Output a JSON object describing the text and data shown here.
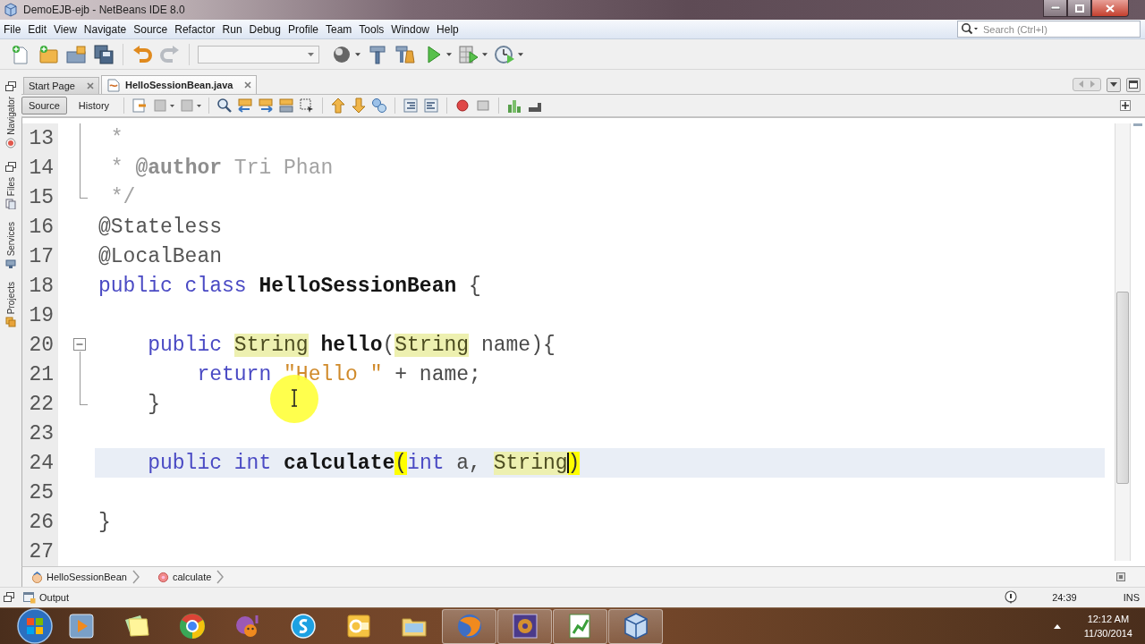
{
  "window": {
    "title": "DemoEJB-ejb - NetBeans IDE 8.0"
  },
  "menu": [
    "File",
    "Edit",
    "View",
    "Navigate",
    "Source",
    "Refactor",
    "Run",
    "Debug",
    "Profile",
    "Team",
    "Tools",
    "Window",
    "Help"
  ],
  "search": {
    "placeholder": "Search (Ctrl+I)"
  },
  "side_panels": [
    {
      "tabs": [
        {
          "label": "Navigator",
          "kind": "navigator"
        }
      ]
    },
    {
      "tabs": [
        {
          "label": "Files",
          "kind": "files"
        },
        {
          "label": "Services",
          "kind": "services"
        },
        {
          "label": "Projects",
          "kind": "projects"
        }
      ]
    }
  ],
  "editor_tabs": [
    {
      "label": "Start Page",
      "kind": "page",
      "selected": false
    },
    {
      "label": "HelloSessionBean.java",
      "kind": "java-file",
      "selected": true
    }
  ],
  "view_buttons": [
    {
      "label": "Source",
      "selected": true
    },
    {
      "label": "History",
      "selected": false
    }
  ],
  "code": {
    "lines": [
      {
        "number": "13",
        "current": false,
        "fold_guide": true,
        "fold_end": false,
        "tokens": [
          {
            "text": " *",
            "kind": "comment"
          }
        ]
      },
      {
        "number": "14",
        "current": false,
        "fold_guide": true,
        "fold_end": false,
        "tokens": [
          {
            "text": " * ",
            "kind": "comment"
          },
          {
            "text": "@author",
            "kind": "doc-tag"
          },
          {
            "text": " Tri Phan",
            "kind": "comment"
          }
        ]
      },
      {
        "number": "15",
        "current": false,
        "fold_guide": false,
        "fold_end": true,
        "tokens": [
          {
            "text": " */",
            "kind": "comment"
          }
        ]
      },
      {
        "number": "16",
        "current": false,
        "fold_guide": false,
        "fold_end": false,
        "tokens": [
          {
            "text": "@Stateless",
            "kind": "annotation"
          }
        ]
      },
      {
        "number": "17",
        "current": false,
        "fold_guide": false,
        "fold_end": false,
        "tokens": [
          {
            "text": "@LocalBean",
            "kind": "annotation"
          }
        ]
      },
      {
        "number": "18",
        "current": false,
        "fold_guide": false,
        "fold_end": false,
        "tokens": [
          {
            "text": "public class ",
            "kind": "keyword"
          },
          {
            "text": "HelloSessionBean",
            "kind": "declaration"
          },
          {
            "text": " {",
            "kind": "plain"
          }
        ],
        "children": [
          {
            "number": "19",
            "current": false,
            "fold_guide": false,
            "fold_end": false
          },
          {
            "number": "20",
            "current": false,
            "fold_guide": false,
            "fold_end": false,
            "expanded": true,
            "tokens": [
              {
                "text": "public ",
                "kind": "keyword"
              },
              {
                "text": "String",
                "kind": "occurrence"
              },
              {
                "text": " hello",
                "kind": "declaration"
              },
              {
                "text": "(",
                "kind": "plain"
              },
              {
                "text": "String",
                "kind": "occurrence"
              },
              {
                "text": " name){",
                "kind": "plain"
              }
            ],
            "children": [
              {
                "number": "21",
                "current": false,
                "fold_guide": true,
                "fold_end": false,
                "tokens": [
                  {
                    "text": "return ",
                    "kind": "keyword"
                  },
                  {
                    "text": "\"Hello \"",
                    "kind": "string"
                  },
                  {
                    "text": " + name;",
                    "kind": "plain"
                  }
                ]
              }
            ]
          },
          {
            "number": "22",
            "current": false,
            "fold_guide": false,
            "fold_end": true,
            "tokens": [
              {
                "text": "}",
                "kind": "plain"
              }
            ]
          },
          {
            "number": "23",
            "current": false,
            "fold_guide": false,
            "fold_end": false
          },
          {
            "number": "24",
            "current": true,
            "fold_guide": false,
            "fold_end": false,
            "tokens": [
              {
                "text": "public int ",
                "kind": "keyword"
              },
              {
                "text": "calculate",
                "kind": "declaration"
              },
              {
                "text": "(",
                "kind": "brace-match"
              },
              {
                "text": "int",
                "kind": "keyword"
              },
              {
                "text": " a, ",
                "kind": "plain"
              },
              {
                "text": "String",
                "kind": "occurrence"
              },
              {
                "text": ")",
                "kind": "brace-match",
                "caret": true
              }
            ]
          },
          {
            "number": "25",
            "current": false,
            "fold_guide": false,
            "fold_end": false
          }
        ]
      },
      {
        "number": "26",
        "current": false,
        "fold_guide": false,
        "fold_end": false,
        "tokens": [
          {
            "text": "}",
            "kind": "plain"
          }
        ]
      },
      {
        "number": "27",
        "current": false,
        "fold_guide": false,
        "fold_end": false
      }
    ]
  },
  "breadcrumbs": [
    {
      "label": "HelloSessionBean",
      "kind": "class"
    },
    {
      "label": "calculate",
      "kind": "method"
    }
  ],
  "output_tab": {
    "label": "Output"
  },
  "status_bar": {
    "position": "24:39",
    "mode": "INS"
  },
  "taskbar": {
    "items": [
      {
        "kind": "play-tile",
        "running": false
      },
      {
        "kind": "notes",
        "running": false
      },
      {
        "kind": "tricolor-circle",
        "running": false
      },
      {
        "kind": "smiley",
        "running": false
      },
      {
        "kind": "cloud",
        "running": false
      },
      {
        "kind": "envelope",
        "running": false
      },
      {
        "kind": "folder",
        "running": false
      },
      {
        "kind": "globe",
        "running": true
      },
      {
        "kind": "emblem",
        "running": true
      },
      {
        "kind": "spreadsheet",
        "running": true
      },
      {
        "kind": "cube",
        "running": true
      }
    ],
    "clock": {
      "time": "12:12 AM",
      "date": "11/30/2014"
    }
  }
}
